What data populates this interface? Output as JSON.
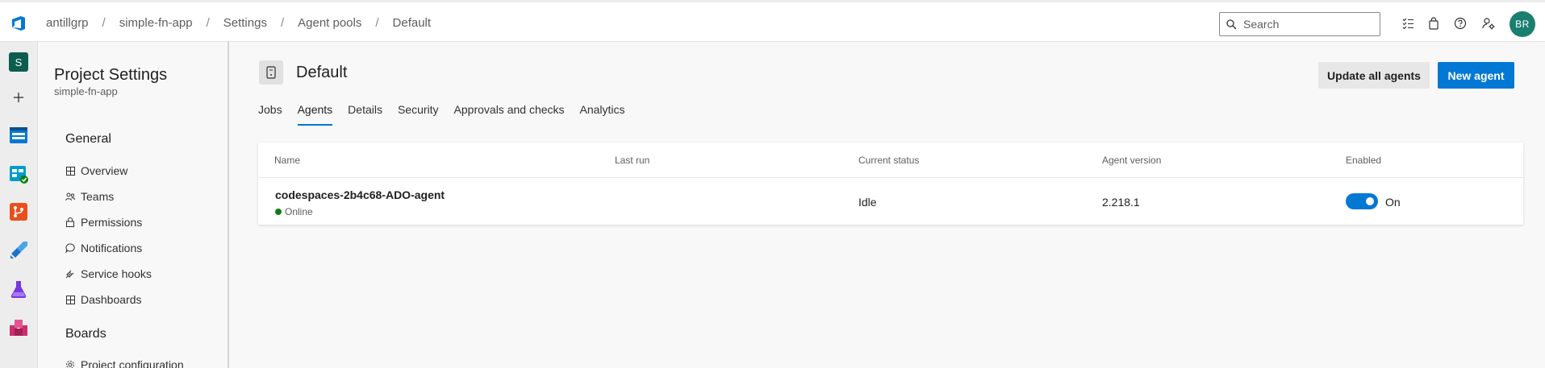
{
  "breadcrumb": [
    "antillgrp",
    "simple-fn-app",
    "Settings",
    "Agent pools",
    "Default"
  ],
  "search": {
    "placeholder": "Search"
  },
  "user": {
    "initials": "BR"
  },
  "rail": {
    "project_initial": "S"
  },
  "settings_nav": {
    "title": "Project Settings",
    "project": "simple-fn-app",
    "general_title": "General",
    "general_items": [
      "Overview",
      "Teams",
      "Permissions",
      "Notifications",
      "Service hooks",
      "Dashboards"
    ],
    "boards_title": "Boards",
    "boards_items": [
      "Project configuration"
    ]
  },
  "pool": {
    "title": "Default"
  },
  "actions": {
    "update_all": "Update all agents",
    "new_agent": "New agent"
  },
  "tabs": [
    "Jobs",
    "Agents",
    "Details",
    "Security",
    "Approvals and checks",
    "Analytics"
  ],
  "active_tab": "Agents",
  "table": {
    "columns": [
      "Name",
      "Last run",
      "Current status",
      "Agent version",
      "Enabled"
    ],
    "rows": [
      {
        "name": "codespaces-2b4c68-ADO-agent",
        "online": "Online",
        "last_run": "",
        "status": "Idle",
        "version": "2.218.1",
        "enabled": "On"
      }
    ]
  },
  "colors": {
    "accent": "#0078d4",
    "online": "#107c10",
    "avatar": "#1b7f6f"
  }
}
